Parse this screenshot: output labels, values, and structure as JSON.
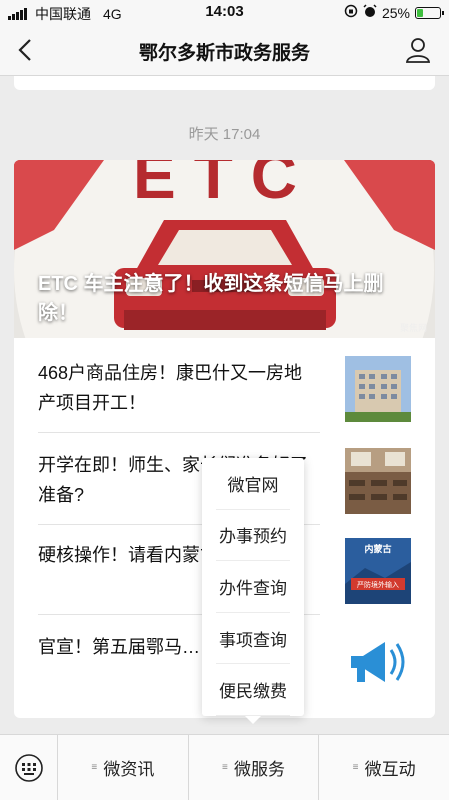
{
  "status": {
    "carrier": "中国联通",
    "network": "4G",
    "time": "14:03",
    "battery": "25%",
    "battery_level": 0.25
  },
  "nav": {
    "title": "鄂尔多斯市政务服务"
  },
  "feed": {
    "timestamp": "昨天 17:04",
    "hero": {
      "banner_text": "ETC",
      "title": "ETC 车主注意了！收到这条短信马上删除！",
      "watermark": "聚焦网"
    },
    "items": [
      {
        "title": "468户商品住房！康巴什又一房地产项目开工！"
      },
      {
        "title": "开学在即！师生、家长们准备好了准备?"
      },
      {
        "title": "硬核操作！请看内蒙古……理"
      },
      {
        "title": "官宣！第五届鄂马……迟！"
      }
    ],
    "thumb3_text_1": "内蒙古",
    "thumb3_text_2": "严防境外输入"
  },
  "popup_menu": {
    "items": [
      "微官网",
      "办事预约",
      "办件查询",
      "事项查询",
      "便民缴费"
    ]
  },
  "menu_bar": {
    "tabs": [
      "微资讯",
      "微服务",
      "微互动"
    ]
  },
  "colors": {
    "hero_red": "#c9353a",
    "battery_green": "#3fbf3f"
  }
}
